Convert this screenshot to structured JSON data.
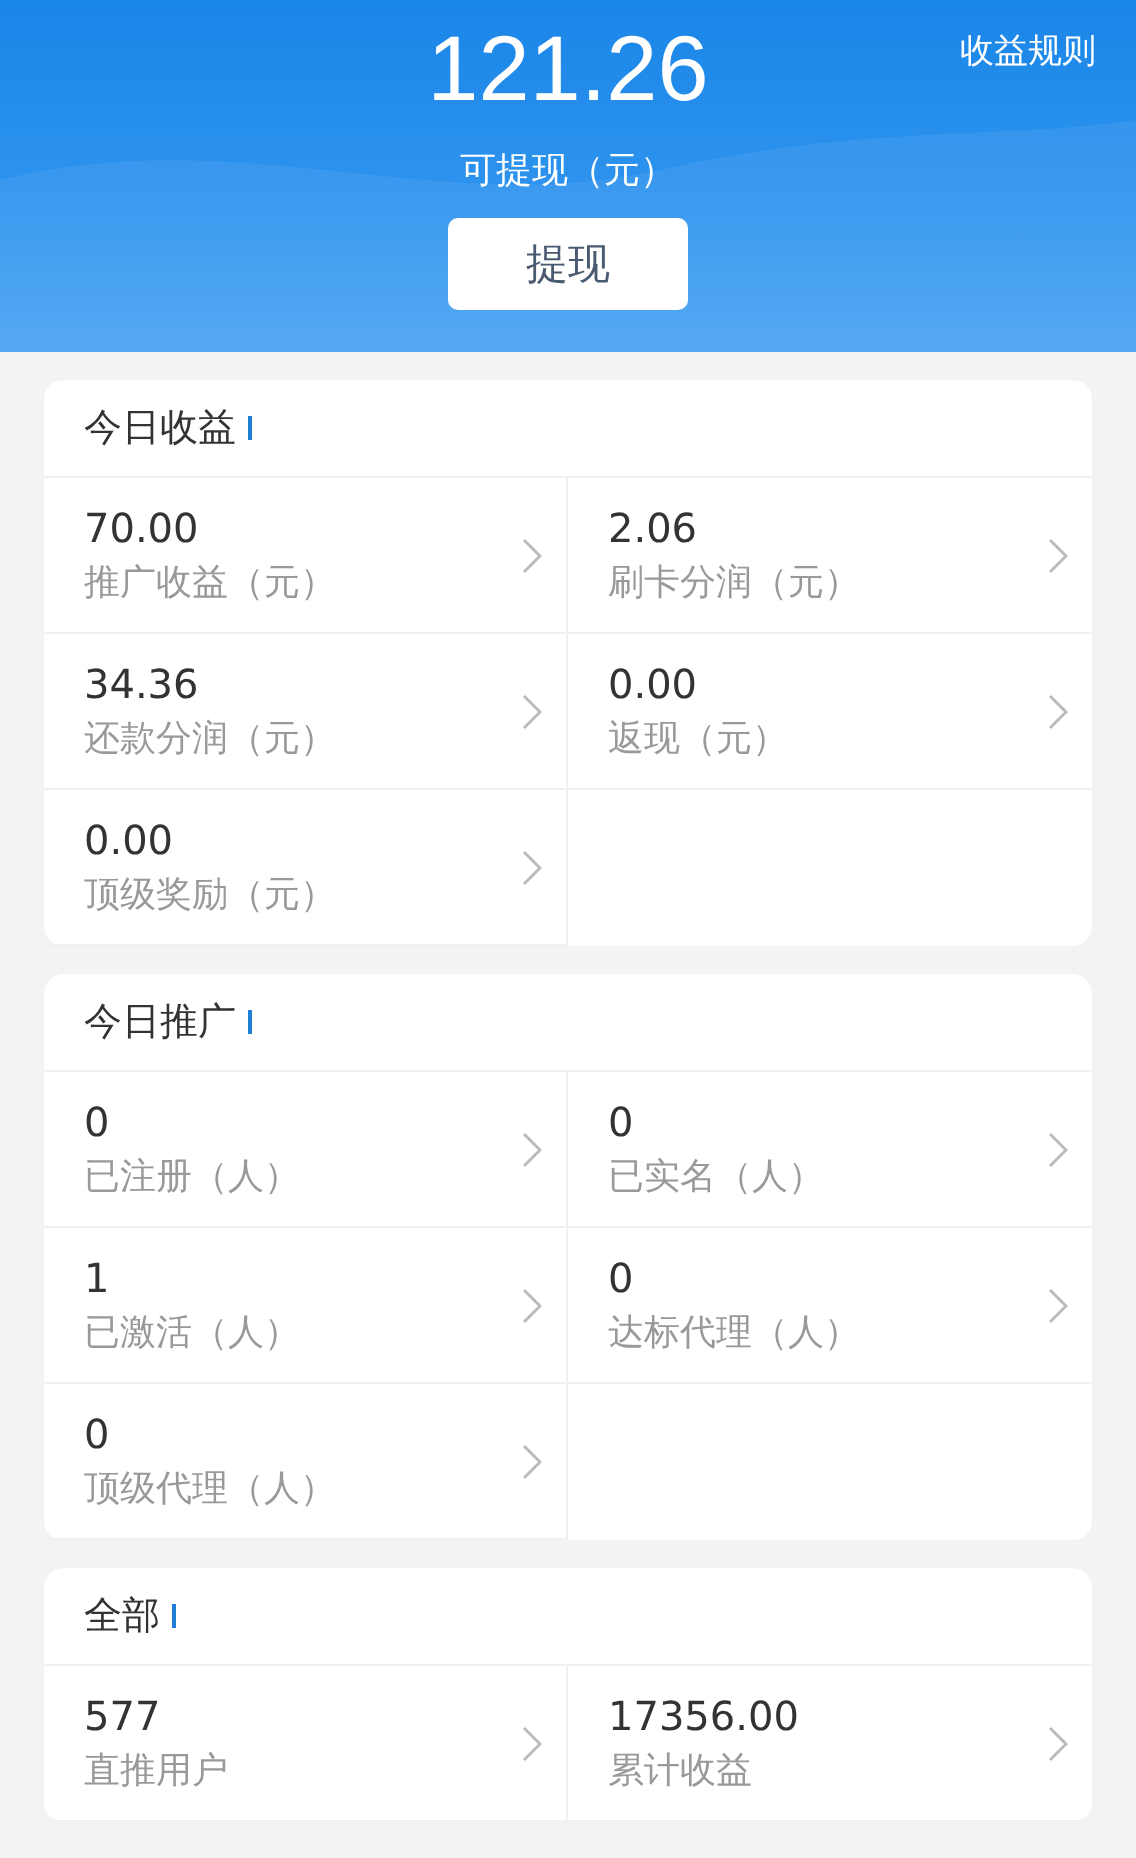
{
  "header": {
    "balance": "121.26",
    "balance_label": "可提现（元）",
    "withdraw_button": "提现",
    "rules_link": "收益规则"
  },
  "sections": [
    {
      "title": "今日收益",
      "items": [
        {
          "value": "70.00",
          "label": "推广收益（元）"
        },
        {
          "value": "2.06",
          "label": "刷卡分润（元）"
        },
        {
          "value": "34.36",
          "label": "还款分润（元）"
        },
        {
          "value": "0.00",
          "label": "返现（元）"
        },
        {
          "value": "0.00",
          "label": "顶级奖励（元）"
        }
      ]
    },
    {
      "title": "今日推广",
      "items": [
        {
          "value": "0",
          "label": "已注册（人）"
        },
        {
          "value": "0",
          "label": "已实名（人）"
        },
        {
          "value": "1",
          "label": "已激活（人）"
        },
        {
          "value": "0",
          "label": "达标代理（人）"
        },
        {
          "value": "0",
          "label": "顶级代理（人）"
        }
      ]
    },
    {
      "title": "全部",
      "items": [
        {
          "value": "577",
          "label": "直推用户"
        },
        {
          "value": "17356.00",
          "label": "累计收益"
        }
      ]
    }
  ]
}
